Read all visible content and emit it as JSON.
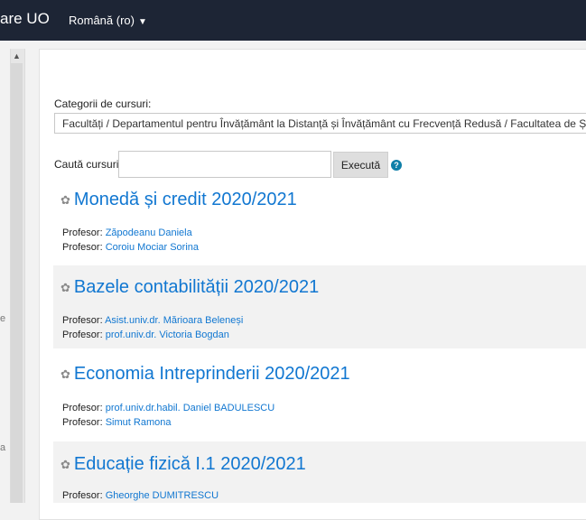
{
  "header": {
    "brand": "are UO",
    "language": "Română (ro)"
  },
  "drawer_fragments": [
    "e",
    "a"
  ],
  "page": {
    "categories_label": "Categorii de cursuri:",
    "category_selected": "Facultăți / Departamentul pentru Învățământ la Distanță și Învățământ cu Frecvență Redusă / Facultatea de Ști",
    "search_label": "Caută cursuri",
    "search_value": "",
    "search_button": "Execută",
    "help_icon": "?"
  },
  "courses": [
    {
      "title": "Monedă și credit 2020/2021",
      "teachers": [
        {
          "role": "Profesor:",
          "name": "Zăpodeanu Daniela"
        },
        {
          "role": "Profesor:",
          "name": "Coroiu Mociar Sorina"
        }
      ]
    },
    {
      "title": "Bazele contabilității 2020/2021",
      "teachers": [
        {
          "role": "Profesor:",
          "name": "Asist.univ.dr. Mărioara Beleneși"
        },
        {
          "role": "Profesor:",
          "name": "prof.univ.dr. Victoria Bogdan"
        }
      ]
    },
    {
      "title": "Economia Intreprinderii 2020/2021",
      "teachers": [
        {
          "role": "Profesor:",
          "name": "prof.univ.dr.habil. Daniel BADULESCU"
        },
        {
          "role": "Profesor:",
          "name": "Simut Ramona"
        }
      ]
    },
    {
      "title": "Educație fizică I.1 2020/2021",
      "teachers": [
        {
          "role": "Profesor:",
          "name": "Gheorghe DUMITRESCU"
        }
      ]
    }
  ]
}
